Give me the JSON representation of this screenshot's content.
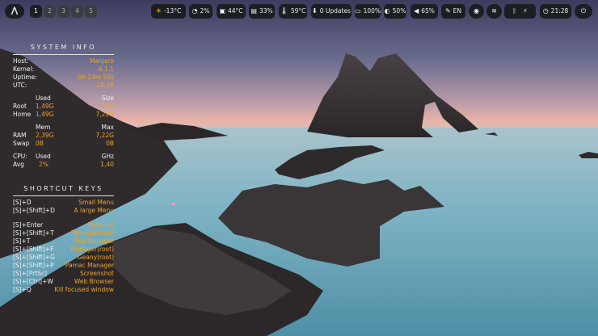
{
  "topbar": {
    "workspaces": [
      "1",
      "2",
      "3",
      "4",
      "5"
    ],
    "weather": "-13°C",
    "cpu": "2%",
    "cpu_temp": "44°C",
    "mem": "33%",
    "gpu_temp": "59°C",
    "updates": "0 Updates",
    "battery": "100%",
    "brightness": "50%",
    "volume": "65%",
    "keyboard": "EN",
    "time": "21:28"
  },
  "sysinfo": {
    "title": "SYSTEM INFO",
    "host_label": "Host:",
    "host_value": "Manjaro",
    "kernel_label": "Kernel:",
    "kernel_value": "6.1.1",
    "uptime_label": "Uptime:",
    "uptime_value": "0h 24m 59s",
    "utc_label": "UTC:",
    "utc_value": "18:28",
    "disk_header_used": "Used",
    "disk_header_size": "Size",
    "root_label": "Root",
    "root_used": "1,49G",
    "root_size": "22G",
    "home_label": "Home",
    "home_used": "1,49G",
    "home_size": "7,22G",
    "mem_header_mem": "Mem",
    "mem_header_max": "Max",
    "ram_label": "RAM",
    "ram_used": "2,39G",
    "ram_max": "7,22G",
    "swap_label": "Swap",
    "swap_used": "0B",
    "swap_max": "0B",
    "cpu_header_label": "CPU:",
    "cpu_header_used": "Used",
    "cpu_header_ghz": "GHz",
    "avg_label": "Avg",
    "avg_used": "2%",
    "avg_ghz": "1,40"
  },
  "shortcuts": {
    "title": "SHORTCUT KEYS",
    "items": [
      {
        "key": "[S]+D",
        "action": "Small Menu"
      },
      {
        "key": "[S]+[Shift]+D",
        "action": "A large Menu"
      },
      {
        "key": "[S]+Enter",
        "action": "Terminal"
      },
      {
        "key": "[S]+[Shift]+T",
        "action": "Terminal(root)"
      },
      {
        "key": "[S]+T",
        "action": "File Manager"
      },
      {
        "key": "[S]+[Shift]+F",
        "action": "Manager(root)"
      },
      {
        "key": "[S]+[Shift]+G",
        "action": "Geany(root)"
      },
      {
        "key": "[S]+[Shift]+P",
        "action": "Pamac Manager"
      },
      {
        "key": "[S]+[PrtSc]",
        "action": "Screenshot"
      },
      {
        "key": "[S]+[Ctrl]+W",
        "action": "Web Browser"
      },
      {
        "key": "[S]+Q",
        "action": "Kill focused window"
      }
    ]
  }
}
